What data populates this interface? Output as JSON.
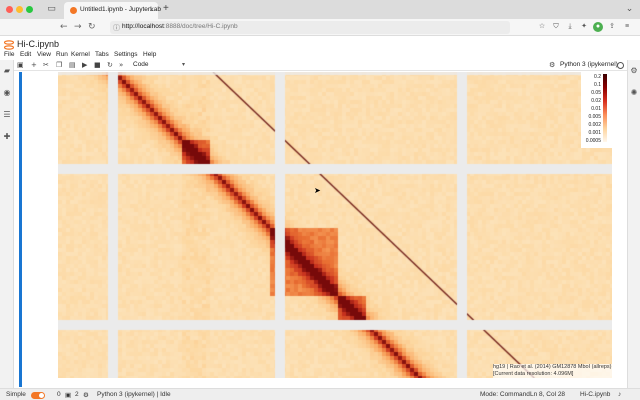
{
  "browser": {
    "tab_title": "Untitled1.ipynb - JupyterLab",
    "url_host": "http://localhost",
    "url_rest": ":8888/doc/tree/Hi-C.ipynb",
    "colors": {
      "close": "#ff5f57",
      "minimize": "#febc2e",
      "maximize": "#28c840"
    }
  },
  "notebook": {
    "title": "Hi-C.ipynb",
    "menu": [
      "File",
      "Edit",
      "View",
      "Run",
      "Kernel",
      "Tabs",
      "Settings",
      "Help"
    ],
    "cell_type": "Code",
    "kernel": "Python 3 (ipykernel)"
  },
  "colorbar": {
    "ticks": [
      "0.2",
      "0.1",
      "0.05",
      "0.02",
      "0.01",
      "0.005",
      "0.002",
      "0.001",
      "0.0005"
    ]
  },
  "attribution": {
    "line1": "hg19 | Rao et al. (2014) GM12878 MboI (allreps) 1kb",
    "line2": "[Current data resolution: 4.096M]"
  },
  "status": {
    "mode_label": "Simple",
    "terminals": "0",
    "kernels": "2",
    "kernel_state": "Python 3 (ipykernel) | Idle",
    "mode": "Mode: Command",
    "position": "Ln 8, Col 28",
    "file": "Hi-C.ipynb"
  },
  "icons": [
    "sidebar-icon",
    "shield-icon",
    "back-icon",
    "forward-icon",
    "reload-icon",
    "folder-icon",
    "running-icon",
    "toc-icon",
    "extension-icon",
    "settings-icon"
  ],
  "heatmap": {
    "blocks": [
      [
        0.22,
        0.27
      ],
      [
        0.38,
        0.5
      ],
      [
        0.5,
        0.55
      ],
      [
        0.68,
        0.95
      ]
    ],
    "gaps": [
      0.0,
      0.175,
      0.36,
      0.535,
      0.71,
      0.87
    ]
  }
}
